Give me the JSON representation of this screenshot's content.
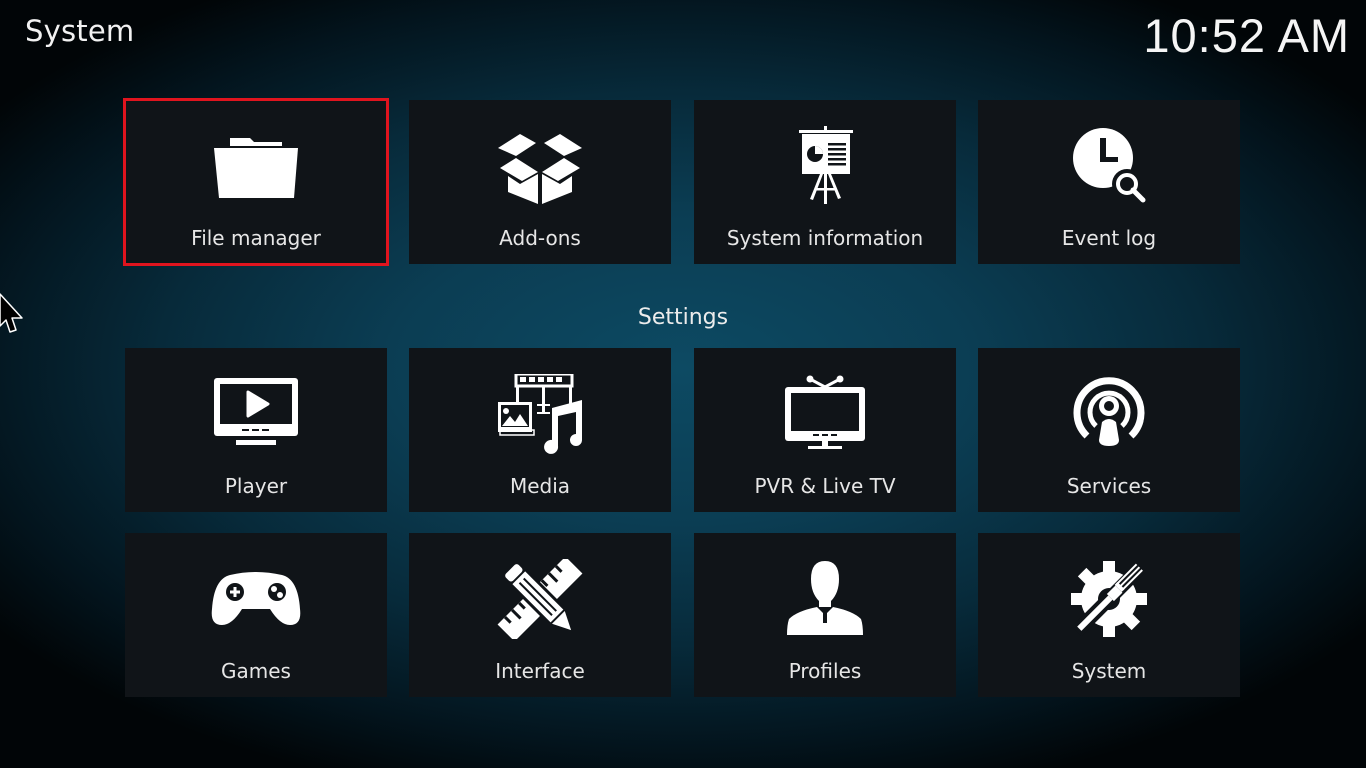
{
  "window": {
    "title": "System",
    "clock": "10:52 AM"
  },
  "top_items": [
    {
      "label": "File manager",
      "icon": "folder-icon",
      "focused": true
    },
    {
      "label": "Add-ons",
      "icon": "open-box-icon"
    },
    {
      "label": "System information",
      "icon": "presentation-board-icon"
    },
    {
      "label": "Event log",
      "icon": "clock-search-icon"
    }
  ],
  "settings_section": {
    "title": "Settings",
    "items": [
      {
        "label": "Player",
        "icon": "monitor-play-icon"
      },
      {
        "label": "Media",
        "icon": "media-film-image-music-icon"
      },
      {
        "label": "PVR & Live TV",
        "icon": "tv-antenna-icon"
      },
      {
        "label": "Services",
        "icon": "broadcast-person-icon"
      },
      {
        "label": "Games",
        "icon": "gamepad-icon"
      },
      {
        "label": "Interface",
        "icon": "ruler-pencil-icon"
      },
      {
        "label": "Profiles",
        "icon": "person-silhouette-icon"
      },
      {
        "label": "System",
        "icon": "gear-wrench-icon"
      }
    ]
  },
  "colors": {
    "focus_border": "#e0141e",
    "tile_bg": "#101418",
    "accent_bg": "#0b3d53"
  }
}
